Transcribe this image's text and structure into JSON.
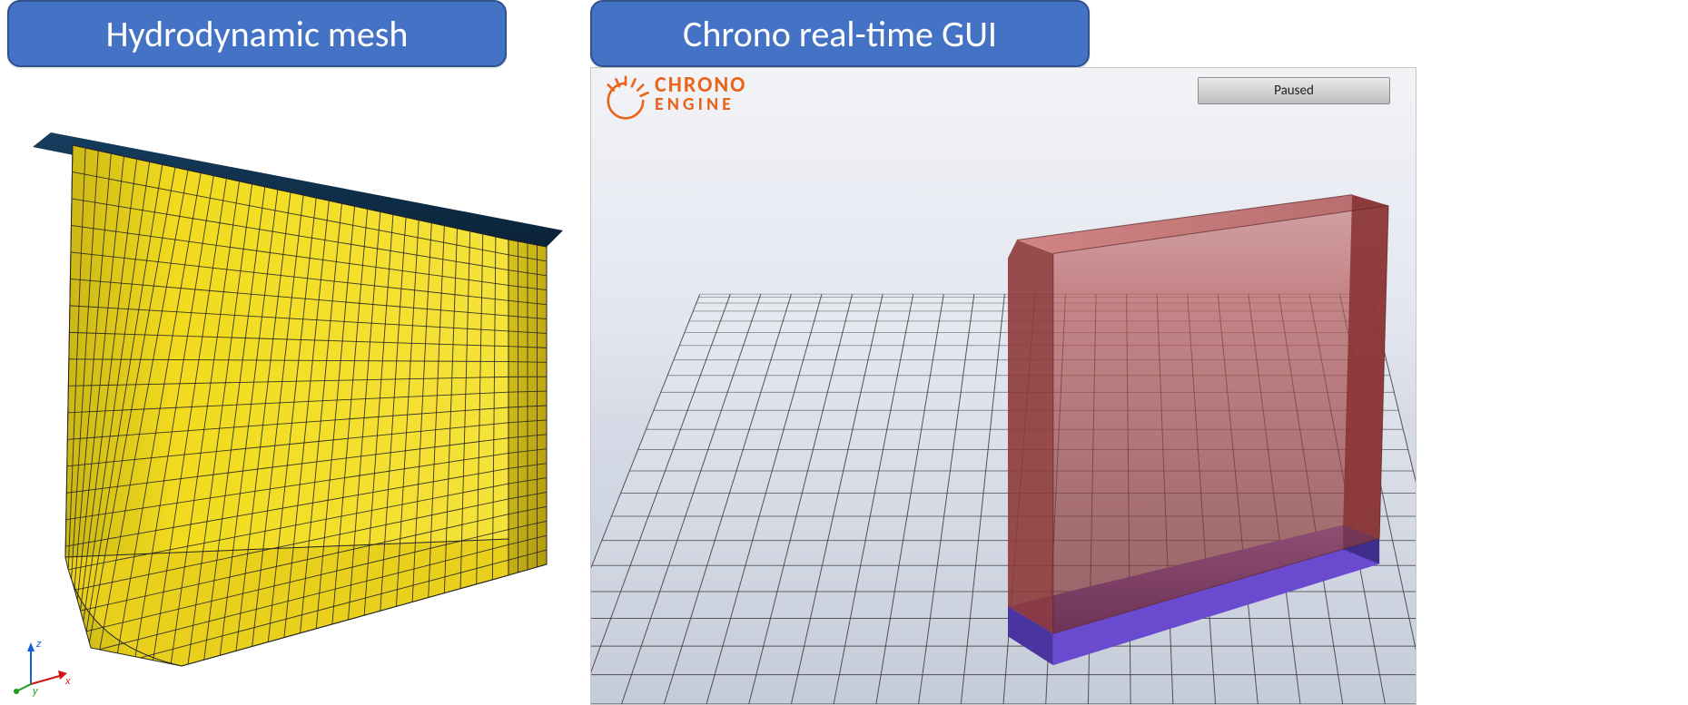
{
  "titles": {
    "left": "Hydrodynamic mesh",
    "right": "Chrono real-time GUI"
  },
  "left_panel": {
    "description": "Perspective rendering of a finite-element hydrodynamic mesh of a ship-like hull section. Yellow quadrilateral mesh on hull surfaces with dark edges, flat dark top plate, rounded bilge at bottom.",
    "mesh_color": "#f2db1e",
    "edge_color": "#232323",
    "top_plate_color": "#0e2f4d",
    "axis": {
      "x": "x",
      "y": "y",
      "z": "z"
    }
  },
  "right_panel": {
    "logo": {
      "line1": "CHRONO",
      "line2": "ENGINE",
      "brand_color": "#e8641b"
    },
    "status_button": "Paused",
    "scene": {
      "description": "Chrono 3D viewport: ground grid receding in perspective, a tall red translucent box (the hydrodynamic body) resting on a thin purple base box.",
      "ground_color": "#d9dde7",
      "grid_color": "#2b2b2b",
      "body_color": "#a13a3a",
      "body_opacity": 0.68,
      "base_color": "#6a4bd0"
    }
  }
}
